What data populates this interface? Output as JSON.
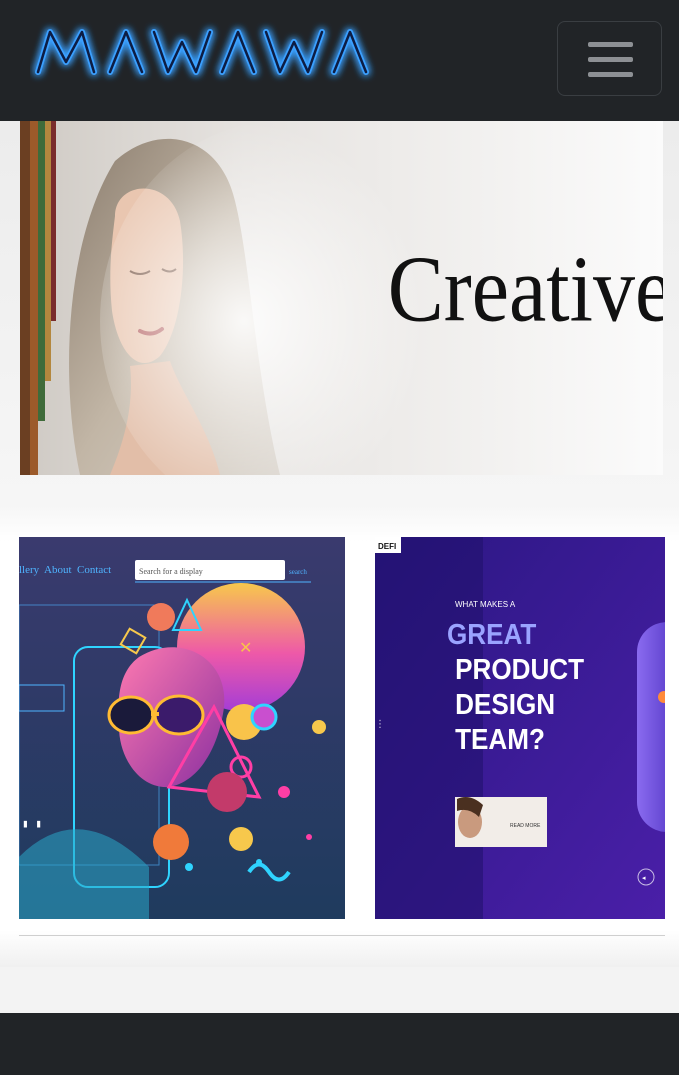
{
  "brand": {
    "logo_text": "MAWAWA"
  },
  "nav": {
    "toggle_label": "Toggle navigation"
  },
  "hero": {
    "title": "Creative"
  },
  "card_left": {
    "nav_items": [
      "llery",
      "About",
      "Contact"
    ],
    "search_placeholder": "Search for a display",
    "search_button": "search"
  },
  "card_right": {
    "tag": "DEFI",
    "kicker": "WHAT MAKES A",
    "headline_1": "GREAT",
    "headline_2": "PRODUCT",
    "headline_3": "DESIGN",
    "headline_4": "TEAM?",
    "button": "READ MORE"
  },
  "colors": {
    "navbar": "#212427",
    "logo_glow": "#2f8cff",
    "accent_purple": "#4a1fa8"
  }
}
